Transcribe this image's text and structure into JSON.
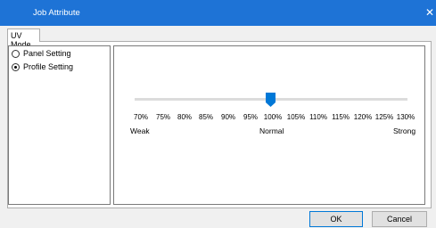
{
  "window": {
    "title": "Job Attribute"
  },
  "tabs": [
    {
      "label": "UV Mode"
    }
  ],
  "mode_options": [
    {
      "label": "Panel Setting",
      "selected": false
    },
    {
      "label": "Profile Setting",
      "selected": true
    }
  ],
  "slider": {
    "ticks": [
      "70%",
      "75%",
      "80%",
      "85%",
      "90%",
      "95%",
      "100%",
      "105%",
      "110%",
      "115%",
      "120%",
      "125%",
      "130%"
    ],
    "value": "100%",
    "weak_label": "Weak",
    "normal_label": "Normal",
    "strong_label": "Strong",
    "thumb_color": "#0078d7"
  },
  "buttons": {
    "ok": "OK",
    "cancel": "Cancel"
  },
  "colors": {
    "titlebar": "#1e73d6",
    "accent": "#0078d7"
  }
}
